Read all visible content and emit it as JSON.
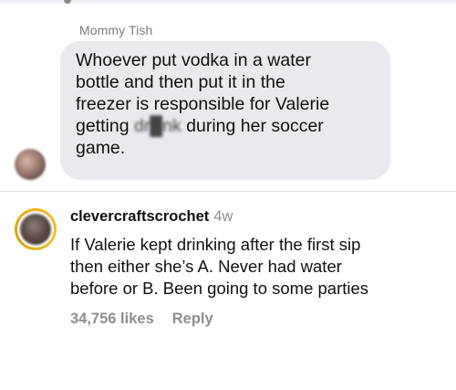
{
  "message": {
    "sender_name": "Mommy Tish",
    "text_before": "Whoever put vodka in a water\nbottle and then put it in the\nfreezer is responsible for Valerie\ngetting ",
    "censored_word": "dr█nk",
    "text_after": " during her soccer\ngame."
  },
  "comment": {
    "username": "clevercraftscrochet",
    "time_ago": "4w",
    "text": "If Valerie kept drinking after the first sip\nthen either she’s A. Never had water\nbefore or B. Been going to some parties",
    "likes": "34,756 likes",
    "reply_label": "Reply"
  },
  "colors": {
    "bubble_background": "#e9e9ee",
    "secondary_text": "#8e8e8e",
    "avatar_ring": "#f6b21a"
  }
}
